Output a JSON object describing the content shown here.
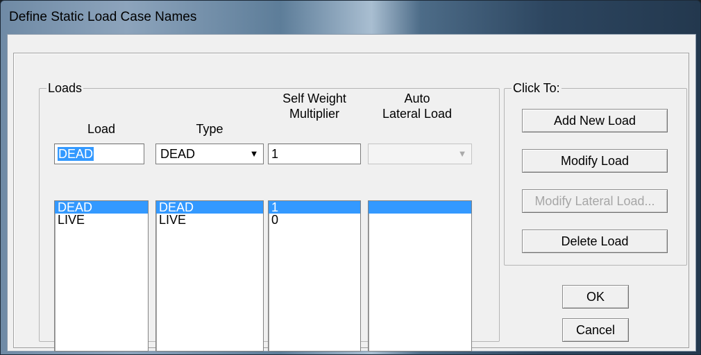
{
  "window": {
    "title": "Define Static Load Case Names"
  },
  "loads": {
    "group_label": "Loads",
    "headers": {
      "load": "Load",
      "type": "Type",
      "self_weight": [
        "Self Weight",
        "Multiplier"
      ],
      "auto_lateral": [
        "Auto",
        "Lateral Load"
      ]
    },
    "edit": {
      "load_value": "DEAD",
      "type_value": "DEAD",
      "multiplier_value": "1",
      "auto_lateral_value": ""
    },
    "rows": [
      {
        "load": "DEAD",
        "type": "DEAD",
        "multiplier": "1",
        "auto_lateral": "",
        "selected": true
      },
      {
        "load": "LIVE",
        "type": "LIVE",
        "multiplier": "0",
        "auto_lateral": "",
        "selected": false
      }
    ]
  },
  "click_to": {
    "group_label": "Click To:",
    "add_new_load": "Add New Load",
    "modify_load": "Modify Load",
    "modify_lateral_load": "Modify Lateral Load...",
    "delete_load": "Delete Load"
  },
  "buttons": {
    "ok": "OK",
    "cancel": "Cancel"
  },
  "colors": {
    "selection": "#3399ff",
    "dialog_bg": "#f0f0f0"
  },
  "icons": {
    "combo_arrow": "chevron-down-icon"
  }
}
